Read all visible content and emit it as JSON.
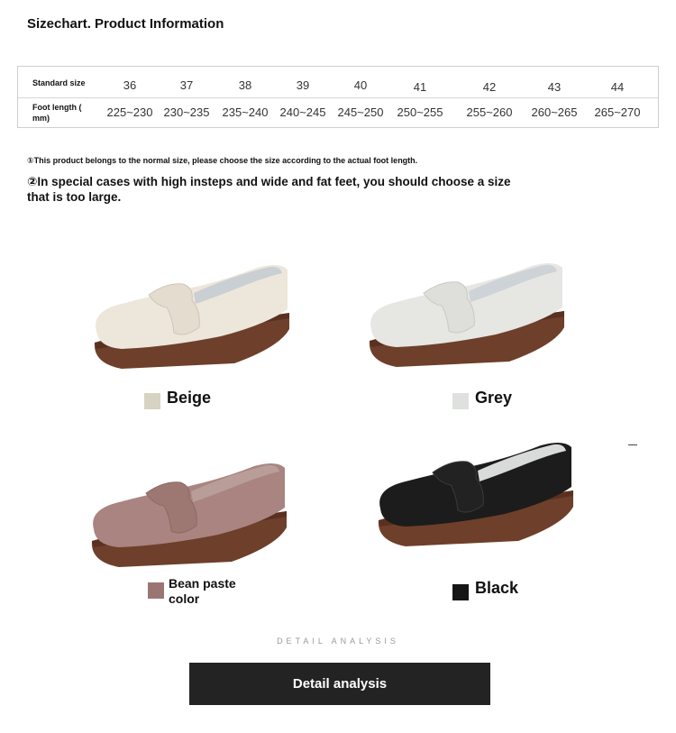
{
  "title": "Sizechart. Product Information",
  "size_table": {
    "row1_header": "Standard size",
    "row2_header": "Foot length ( mm)",
    "sizes": [
      "36",
      "37",
      "38",
      "39",
      "40",
      "41",
      "42",
      "43",
      "44"
    ],
    "lengths": [
      "225~230",
      "230~235",
      "235~240",
      "240~245",
      "245~250",
      "250~255",
      "255~260",
      "260~265",
      "265~270"
    ]
  },
  "notes": {
    "note1": "①This product belongs to the normal size, please choose the size according to the actual foot length.",
    "note2": "②In special cases with high insteps and wide and fat feet, you should choose a size that is too large."
  },
  "colors": [
    {
      "name": "Beige",
      "swatch": "#d8d2c2",
      "upper": "#ece6db",
      "sole": "#6e3f2a"
    },
    {
      "name": "Grey",
      "swatch": "#dfe1df",
      "upper": "#e7e7e3",
      "sole": "#6e3f2a"
    },
    {
      "name": "Bean paste color",
      "swatch": "#9a7672",
      "upper": "#a98480",
      "sole": "#6e3f2a"
    },
    {
      "name": "Black",
      "swatch": "#161616",
      "upper": "#1c1c1c",
      "sole": "#6e3f2a"
    }
  ],
  "detail_heading": "DETAIL ANALYSIS",
  "detail_button": "Detail analysis"
}
